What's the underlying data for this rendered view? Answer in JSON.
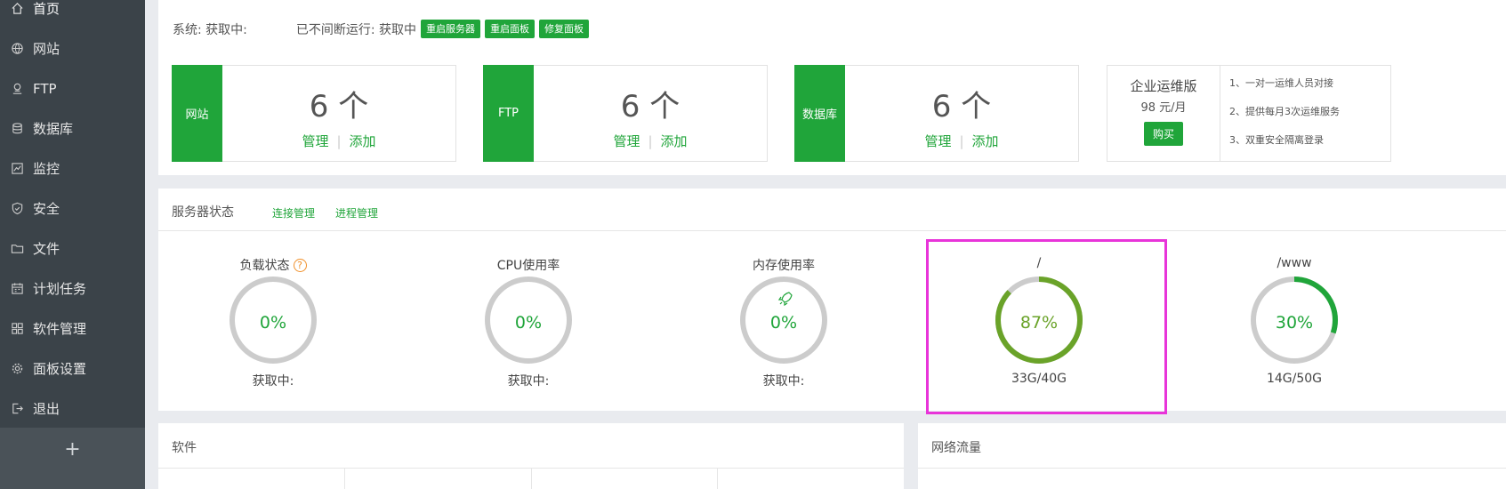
{
  "sidebar": {
    "items": [
      {
        "label": "首页",
        "icon": "home-icon"
      },
      {
        "label": "网站",
        "icon": "globe-icon"
      },
      {
        "label": "FTP",
        "icon": "ftp-icon"
      },
      {
        "label": "数据库",
        "icon": "database-icon"
      },
      {
        "label": "监控",
        "icon": "monitor-icon"
      },
      {
        "label": "安全",
        "icon": "shield-icon"
      },
      {
        "label": "文件",
        "icon": "folder-icon"
      },
      {
        "label": "计划任务",
        "icon": "calendar-icon"
      },
      {
        "label": "软件管理",
        "icon": "grid-icon"
      },
      {
        "label": "面板设置",
        "icon": "gear-icon"
      },
      {
        "label": "退出",
        "icon": "logout-icon"
      }
    ],
    "add_label": "+"
  },
  "top": {
    "system_text": "系统: 获取中:",
    "uptime_text": "已不间断运行: 获取中",
    "buttons": [
      "重启服务器",
      "重启面板",
      "修复面板"
    ]
  },
  "stats": [
    {
      "tag": "网站",
      "count": "6 个",
      "manage": "管理",
      "sep": "|",
      "add": "添加"
    },
    {
      "tag": "FTP",
      "count": "6 个",
      "manage": "管理",
      "sep": "|",
      "add": "添加"
    },
    {
      "tag": "数据库",
      "count": "6 个",
      "manage": "管理",
      "sep": "|",
      "add": "添加"
    }
  ],
  "enterprise": {
    "title": "企业运维版",
    "price": "98 元/月",
    "buy": "购买",
    "features": [
      "1、一对一运维人员对接",
      "2、提供每月3次运维服务",
      "3、双重安全隔离登录"
    ]
  },
  "status": {
    "title": "服务器状态",
    "links": [
      "连接管理",
      "进程管理"
    ],
    "gauges": [
      {
        "title": "负载状态",
        "help": "?",
        "value": "0%",
        "percent": 0,
        "sub": "获取中:"
      },
      {
        "title": "CPU使用率",
        "value": "0%",
        "percent": 0,
        "sub": "获取中:"
      },
      {
        "title": "内存使用率",
        "value": "0%",
        "percent": 0,
        "sub": "获取中:"
      },
      {
        "title": "/",
        "value": "87%",
        "percent": 87,
        "sub": "33G/40G"
      },
      {
        "title": "/www",
        "value": "30%",
        "percent": 30,
        "sub": "14G/50G"
      }
    ]
  },
  "software": {
    "title": "软件"
  },
  "network": {
    "title": "网络流量"
  },
  "colors": {
    "accent": "#20a53a",
    "disk_high": "#6aa329",
    "sidebar_bg": "#3b4349",
    "highlight": "#e834d9"
  }
}
